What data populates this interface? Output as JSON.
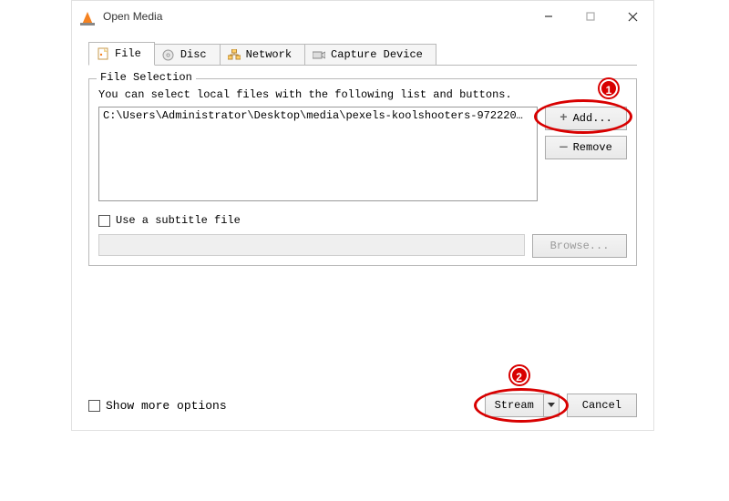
{
  "window": {
    "title": "Open Media"
  },
  "tabs": {
    "file": "File",
    "disc": "Disc",
    "network": "Network",
    "capture": "Capture Device"
  },
  "file_selection": {
    "group_title": "File Selection",
    "hint": "You can select local files with the following list and buttons.",
    "entries": [
      "C:\\Users\\Administrator\\Desktop\\media\\pexels-koolshooters-972220…"
    ],
    "add_label": "Add...",
    "remove_label": "Remove"
  },
  "subtitle": {
    "checkbox_label": "Use a subtitle file",
    "browse_label": "Browse..."
  },
  "footer": {
    "show_more_label": "Show more options",
    "stream_label": "Stream",
    "cancel_label": "Cancel"
  },
  "annotations": {
    "badge1": "1",
    "badge2": "2"
  }
}
